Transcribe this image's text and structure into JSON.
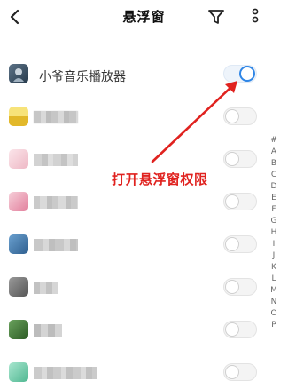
{
  "header": {
    "title": "悬浮窗",
    "back_icon": "chevron-left-icon",
    "filter_icon": "filter-icon",
    "more_icon": "more-vertical-icon"
  },
  "apps": [
    {
      "name": "小爷音乐播放器",
      "enabled": true,
      "icon_color": "#3a4f63"
    },
    {
      "name": "",
      "enabled": false,
      "icon_color": "#e8c93a"
    },
    {
      "name": "",
      "enabled": false,
      "icon_color": "#f1c9d0"
    },
    {
      "name": "",
      "enabled": false,
      "icon_color": "#e99ab0"
    },
    {
      "name": "",
      "enabled": false,
      "icon_color": "#4f82b3"
    },
    {
      "name": "",
      "enabled": false,
      "icon_color": "#777777"
    },
    {
      "name": "",
      "enabled": false,
      "icon_color": "#3f7a35"
    },
    {
      "name": "",
      "enabled": false,
      "icon_color": "#7fd3b6"
    }
  ],
  "alphabet_index": [
    "#",
    "A",
    "B",
    "C",
    "D",
    "E",
    "F",
    "G",
    "H",
    "I",
    "J",
    "K",
    "L",
    "M",
    "N",
    "O",
    "P"
  ],
  "annotation": {
    "text": "打开悬浮窗权限",
    "color": "#e0221f"
  },
  "colors": {
    "toggle_on": "#2f86e6",
    "toggle_off": "#cfcfcf"
  }
}
